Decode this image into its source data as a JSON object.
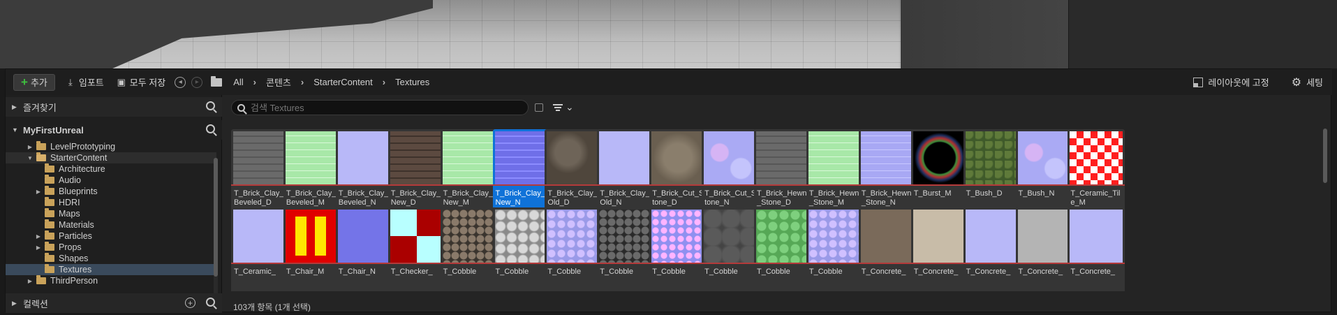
{
  "toolbar": {
    "add_label": "추가",
    "import_label": "임포트",
    "save_all_label": "모두 저장",
    "breadcrumbs": [
      "All",
      "콘텐츠",
      "StarterContent",
      "Textures"
    ],
    "lock_layout_label": "레이아웃에 고정",
    "settings_label": "세팅"
  },
  "sidebar": {
    "favorites_label": "즐겨찾기",
    "project_label": "MyFirstUnreal",
    "collections_label": "컬렉션",
    "tree": [
      {
        "label": "LevelPrototyping",
        "depth": 1,
        "expander": "closed"
      },
      {
        "label": "StarterContent",
        "depth": 1,
        "expander": "open",
        "state": "open"
      },
      {
        "label": "Architecture",
        "depth": 2,
        "expander": "none"
      },
      {
        "label": "Audio",
        "depth": 2,
        "expander": "none"
      },
      {
        "label": "Blueprints",
        "depth": 2,
        "expander": "closed"
      },
      {
        "label": "HDRI",
        "depth": 2,
        "expander": "none"
      },
      {
        "label": "Maps",
        "depth": 2,
        "expander": "none"
      },
      {
        "label": "Materials",
        "depth": 2,
        "expander": "none"
      },
      {
        "label": "Particles",
        "depth": 2,
        "expander": "closed"
      },
      {
        "label": "Props",
        "depth": 2,
        "expander": "closed"
      },
      {
        "label": "Shapes",
        "depth": 2,
        "expander": "none"
      },
      {
        "label": "Textures",
        "depth": 2,
        "expander": "none",
        "state": "selected"
      },
      {
        "label": "ThirdPerson",
        "depth": 1,
        "expander": "closed"
      }
    ]
  },
  "search": {
    "placeholder": "검색 Textures"
  },
  "assets": [
    {
      "name": "T_Brick_Clay_Beveled_D",
      "thumb": "brick-gray"
    },
    {
      "name": "T_Brick_Clay_Beveled_M",
      "thumb": "green-brick"
    },
    {
      "name": "T_Brick_Clay_Beveled_N",
      "thumb": "normal-flat"
    },
    {
      "name": "T_Brick_Clay_New_D",
      "thumb": "brick-brown"
    },
    {
      "name": "T_Brick_Clay_New_M",
      "thumb": "green-brick"
    },
    {
      "name": "T_Brick_Clay_New_N",
      "thumb": "normal-brick",
      "selected": true
    },
    {
      "name": "T_Brick_Clay_Old_D",
      "thumb": "stone-brown"
    },
    {
      "name": "T_Brick_Clay_Old_N",
      "thumb": "normal-flat"
    },
    {
      "name": "T_Brick_Cut_Stone_D",
      "thumb": "stone-tan"
    },
    {
      "name": "T_Brick_Cut_Stone_N",
      "thumb": "normal-blotch"
    },
    {
      "name": "T_Brick_Hewn_Stone_D",
      "thumb": "brick-gray"
    },
    {
      "name": "T_Brick_Hewn_Stone_M",
      "thumb": "green-brick"
    },
    {
      "name": "T_Brick_Hewn_Stone_N",
      "thumb": "normal-brick-light"
    },
    {
      "name": "T_Burst_M",
      "thumb": "burst"
    },
    {
      "name": "T_Bush_D",
      "thumb": "bush"
    },
    {
      "name": "T_Bush_N",
      "thumb": "normal-blotch"
    },
    {
      "name": "T_Ceramic_Tile_M",
      "thumb": "checker-rm"
    },
    {
      "name": "T_Ceramic_",
      "thumb": "normal-flat"
    },
    {
      "name": "T_Chair_M",
      "thumb": "chair-mask"
    },
    {
      "name": "T_Chair_N",
      "thumb": "normal-blue"
    },
    {
      "name": "T_Checker_",
      "thumb": "checker-rc"
    },
    {
      "name": "T_Cobble",
      "thumb": "cobble-color"
    },
    {
      "name": "T_Cobble",
      "thumb": "cobble-gray"
    },
    {
      "name": "T_Cobble",
      "thumb": "normal-cobble"
    },
    {
      "name": "T_Cobble",
      "thumb": "cobble-dark"
    },
    {
      "name": "T_Cobble",
      "thumb": "normal-cobble-pink"
    },
    {
      "name": "T_Cobble",
      "thumb": "cobble-slate"
    },
    {
      "name": "T_Cobble",
      "thumb": "cobble-green"
    },
    {
      "name": "T_Cobble",
      "thumb": "normal-cobble"
    },
    {
      "name": "T_Concrete_",
      "thumb": "concrete-brown"
    },
    {
      "name": "T_Concrete_",
      "thumb": "concrete-beige"
    },
    {
      "name": "T_Concrete_",
      "thumb": "normal-flat"
    },
    {
      "name": "T_Concrete_",
      "thumb": "concrete-gray"
    },
    {
      "name": "T_Concrete_",
      "thumb": "normal-flat"
    }
  ],
  "status": {
    "text": "103개 항목 (1개 선택)"
  },
  "colors": {
    "selection": "#0f72d8",
    "tree_selection": "#3a4a5c",
    "accent_add": "#3fbf3f",
    "folder": "#c9a25a"
  }
}
